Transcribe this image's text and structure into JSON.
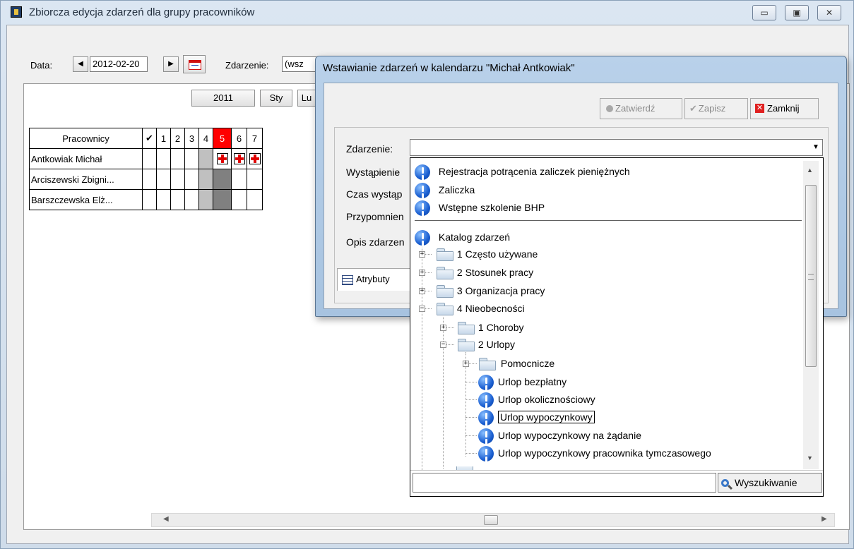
{
  "main": {
    "title": "Zbiorcza edycja zdarzeń dla grupy pracowników",
    "date_label": "Data:",
    "date_value": "2012-02-20",
    "event_label": "Zdarzenie:",
    "event_value": "(wsz",
    "year_button": "2011",
    "month_button": "Sty",
    "month_button2": "Lu"
  },
  "grid": {
    "header": [
      "Pracownicy",
      "✔",
      "1",
      "2",
      "3",
      "4",
      "5",
      "6",
      "7"
    ],
    "employees": [
      "Antkowiak Michał",
      "Arciszewski Zbigni...",
      "Barszczewska Elż..."
    ]
  },
  "dialog": {
    "title": "Wstawianie zdarzeń w kalendarzu \"Michał Antkowiak\"",
    "confirm_label": "Zatwierdź",
    "save_label": "Zapisz",
    "close_label": "Zamknij",
    "event_label": "Zdarzenie:",
    "event_value": "",
    "occurrence_label": "Wystąpienie",
    "time_label": "Czas wystąp",
    "reminder_label": "Przypomnien",
    "description_label": "Opis zdarzen",
    "attributes_tab": "Atrybuty"
  },
  "dropdown": {
    "recent": [
      "Rejestracja potrącenia zaliczek pieniężnych",
      "Zaliczka",
      "Wstępne szkolenie BHP"
    ],
    "catalog": "Katalog zdarzeń",
    "folders": [
      "1 Często używane",
      "2 Stosunek pracy",
      "3 Organizacja pracy",
      "4 Nieobecności"
    ],
    "sub_folders": [
      "1 Choroby",
      "2 Urlopy"
    ],
    "sub_sub_folder": "Pomocnicze",
    "leaves": [
      "Urlop bezpłatny",
      "Urlop okolicznościowy",
      "Urlop wypoczynkowy",
      "Urlop wypoczynkowy na żądanie",
      "Urlop wypoczynkowy pracownika tymczasowego"
    ],
    "selected": "Urlop wypoczynkowy",
    "search_value": "",
    "search_label": "Wyszukiwanie"
  },
  "icons": {
    "info": "info-circle-icon",
    "folder": "folder-icon",
    "search": "magnifier-icon",
    "close": "red-x-icon",
    "confirm": "gray-dot-icon",
    "save": "checkmark-icon",
    "calendar": "calendar-icon"
  },
  "colors": {
    "highlight_day": "#ff0000",
    "weekend_cell": "#c0c0c0",
    "weekend_dark": "#808080",
    "info_blue": "#1b5fd1",
    "close_red": "#e02020"
  }
}
